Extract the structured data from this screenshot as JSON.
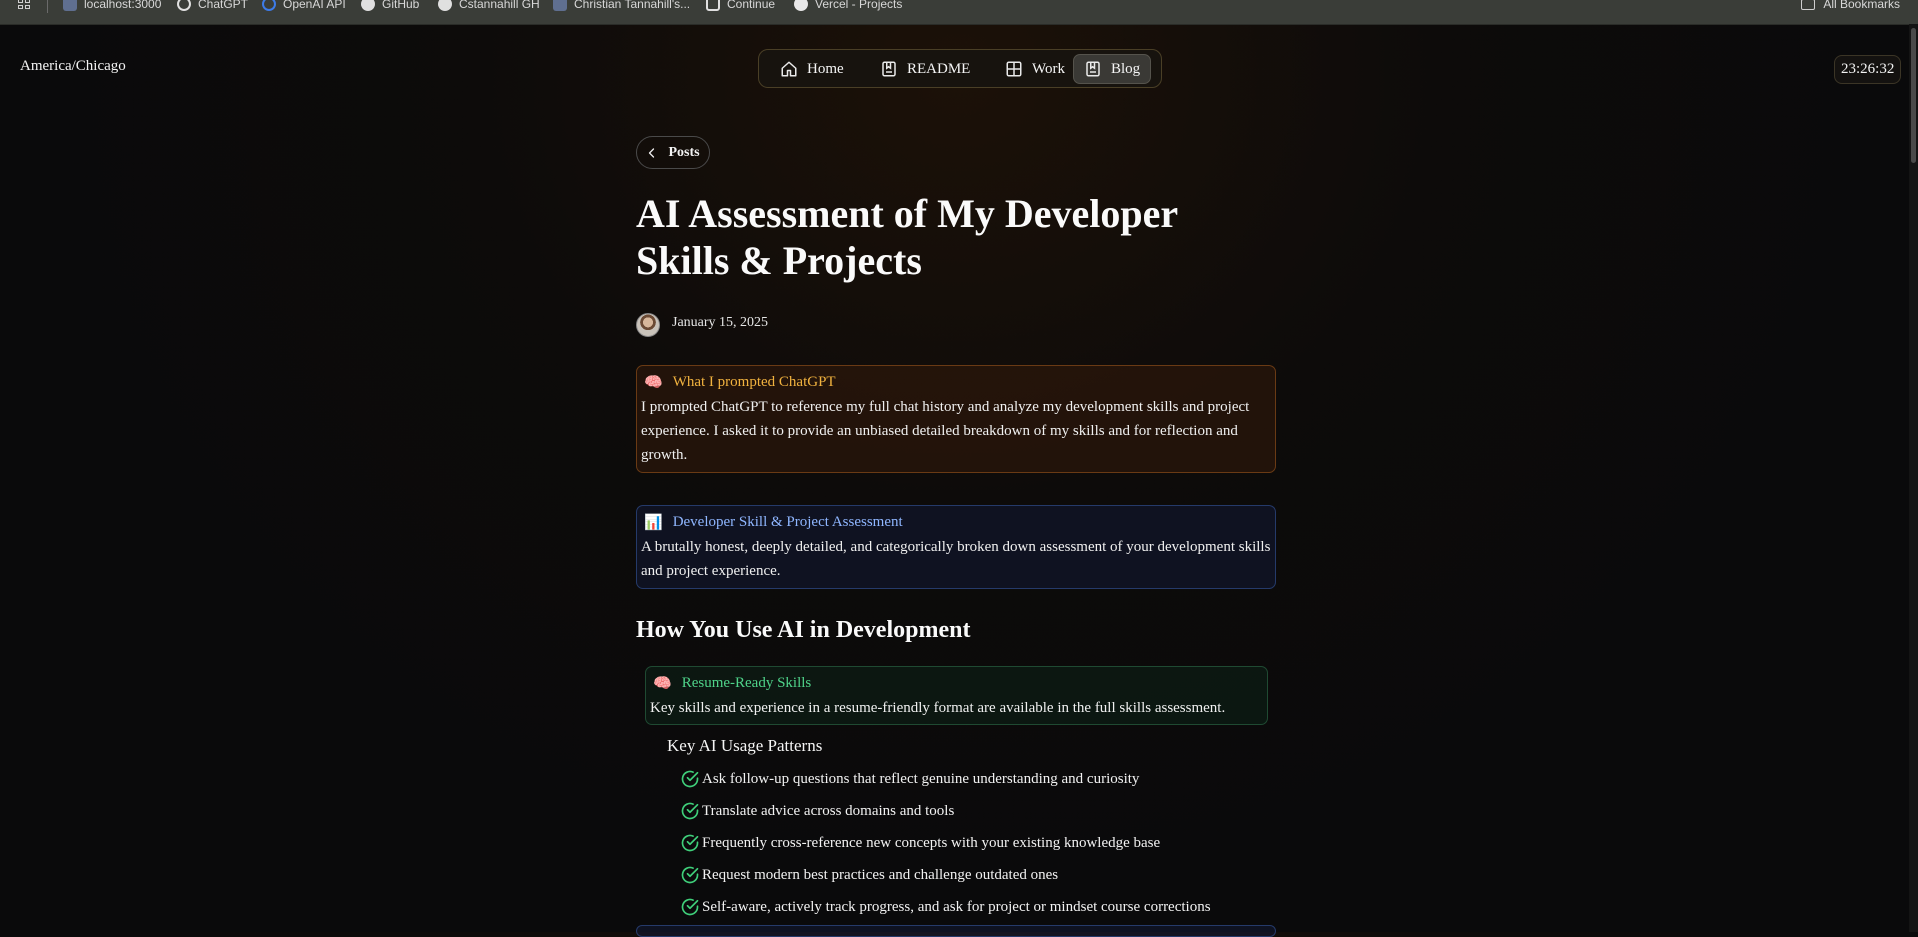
{
  "bookmarks": {
    "items": [
      {
        "label": "localhost:3000",
        "icon": "globe-icon",
        "color": "#7a8fb3"
      },
      {
        "label": "ChatGPT",
        "icon": "openai-icon",
        "color": "#e8e8e8"
      },
      {
        "label": "OpenAI API",
        "icon": "openai-icon",
        "color": "#3d7be8"
      },
      {
        "label": "GitHub",
        "icon": "github-icon",
        "color": "#e8e8e8"
      },
      {
        "label": "Cstannahill GH",
        "icon": "github-icon",
        "color": "#e8e8e8"
      },
      {
        "label": "Christian Tannahill's...",
        "icon": "globe-icon",
        "color": "#7a8fb3"
      },
      {
        "label": "Continue",
        "icon": "continue-icon",
        "color": "#e8e8e8"
      },
      {
        "label": "Vercel - Projects",
        "icon": "vercel-icon",
        "color": "#e8e8e8"
      }
    ],
    "all_bookmarks": "All Bookmarks"
  },
  "header": {
    "timezone": "America/Chicago",
    "clock": "23:26:32",
    "nav": [
      {
        "label": "Home",
        "icon": "home-icon"
      },
      {
        "label": "README",
        "icon": "book-icon"
      },
      {
        "label": "Work",
        "icon": "grid-icon"
      },
      {
        "label": "Blog",
        "icon": "book-icon",
        "active": true
      }
    ]
  },
  "post": {
    "back_label": "Posts",
    "title": "AI Assessment of My Developer Skills & Projects",
    "date": "January 15, 2025",
    "prompt_callout": {
      "emoji": "🧠",
      "title": "What I prompted ChatGPT",
      "body": "I prompted ChatGPT to reference my full chat history and analyze my development skills and project experience. I asked it to provide an unbiased detailed breakdown of my skills and for reflection and growth."
    },
    "assessment_callout": {
      "emoji": "📊",
      "title": "Developer Skill & Project Assessment",
      "body": "A brutally honest, deeply detailed, and categorically broken down assessment of your development skills and project experience."
    },
    "section_heading": "How You Use AI in Development",
    "resume_callout": {
      "emoji": "🧠",
      "title": "Resume-Ready Skills",
      "body": "Key skills and experience in a resume-friendly format are available in the full skills assessment."
    },
    "patterns_heading": "Key AI Usage Patterns",
    "patterns": [
      "Ask follow-up questions that reflect genuine understanding and curiosity",
      "Translate advice across domains and tools",
      "Frequently cross-reference new concepts with your existing knowledge base",
      "Request modern best practices and challenge outdated ones",
      "Self-aware, actively track progress, and ask for project or mindset course corrections"
    ]
  },
  "colors": {
    "accent_orange": "#f1b23f",
    "accent_blue": "#8fb6ff",
    "accent_green": "#4fd389"
  }
}
